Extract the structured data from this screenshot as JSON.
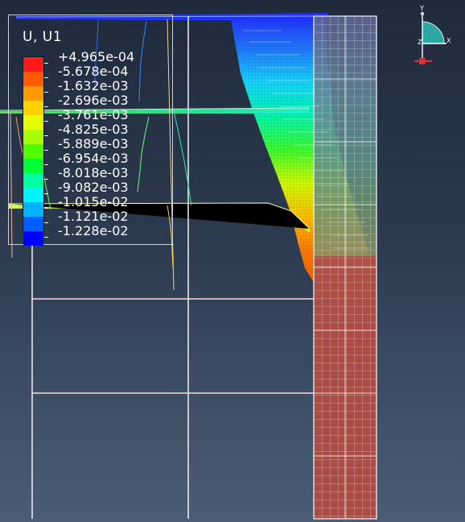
{
  "legend": {
    "title": "U, U1",
    "entries": [
      {
        "label": "+4.965e-04",
        "color": "#ff1a1a"
      },
      {
        "label": "-5.678e-04",
        "color": "#ff5a00"
      },
      {
        "label": "-1.632e-03",
        "color": "#ff9b00"
      },
      {
        "label": "-2.696e-03",
        "color": "#ffd200"
      },
      {
        "label": "-3.761e-03",
        "color": "#e6ff00"
      },
      {
        "label": "-4.825e-03",
        "color": "#a6ff00"
      },
      {
        "label": "-5.889e-03",
        "color": "#4fff00"
      },
      {
        "label": "-6.954e-03",
        "color": "#00ff35"
      },
      {
        "label": "-8.018e-03",
        "color": "#00ffa0"
      },
      {
        "label": "-9.082e-03",
        "color": "#00f4ff"
      },
      {
        "label": "-1.015e-02",
        "color": "#00b2ff"
      },
      {
        "label": "-1.121e-02",
        "color": "#005dff"
      },
      {
        "label": "-1.228e-02",
        "color": "#0000ff"
      }
    ]
  },
  "triad": {
    "y_label": "Y",
    "x_label": "X",
    "z_label": "Z"
  },
  "colors": {
    "background_top": "#1f2a3b",
    "background_bottom": "#4b5d75",
    "frame_line": "#e8edf4",
    "mesh_grid": "#f2f5f8"
  }
}
